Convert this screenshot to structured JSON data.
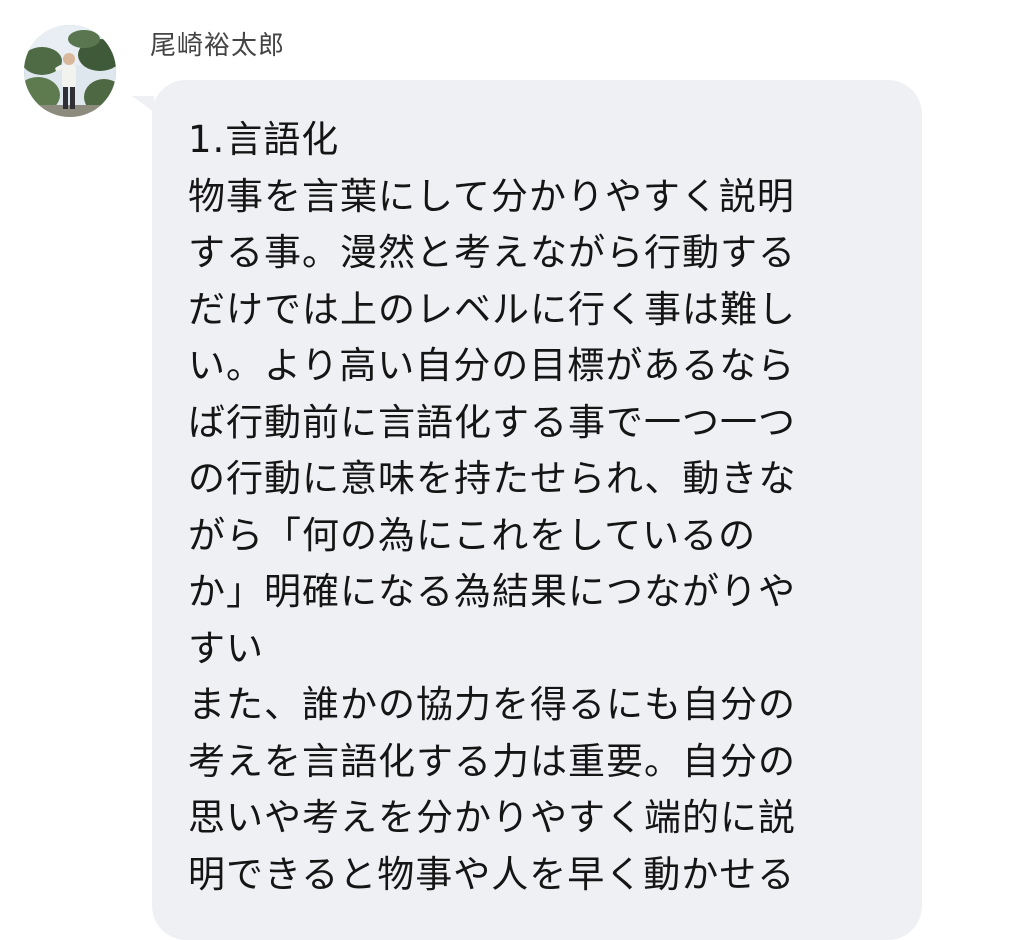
{
  "chat": {
    "sender_name": "尾崎裕太郎",
    "avatar_icon": "person-photo-icon",
    "bubble_color": "#eff0f4",
    "message_lines": [
      "1.言語化",
      "物事を言葉にして分かりやすく説明",
      "する事。漫然と考えながら行動する",
      "だけでは上のレベルに行く事は難し",
      "い。より高い自分の目標があるなら",
      "ば行動前に言語化する事で一つ一つ",
      "の行動に意味を持たせられ、動きな",
      "がら「何の為にこれをしているの",
      "か」明確になる為結果につながりや",
      "すい",
      "また、誰かの協力を得るにも自分の",
      "考えを言語化する力は重要。自分の",
      "思いや考えを分かりやすく端的に説",
      "明できると物事や人を早く動かせる"
    ]
  }
}
